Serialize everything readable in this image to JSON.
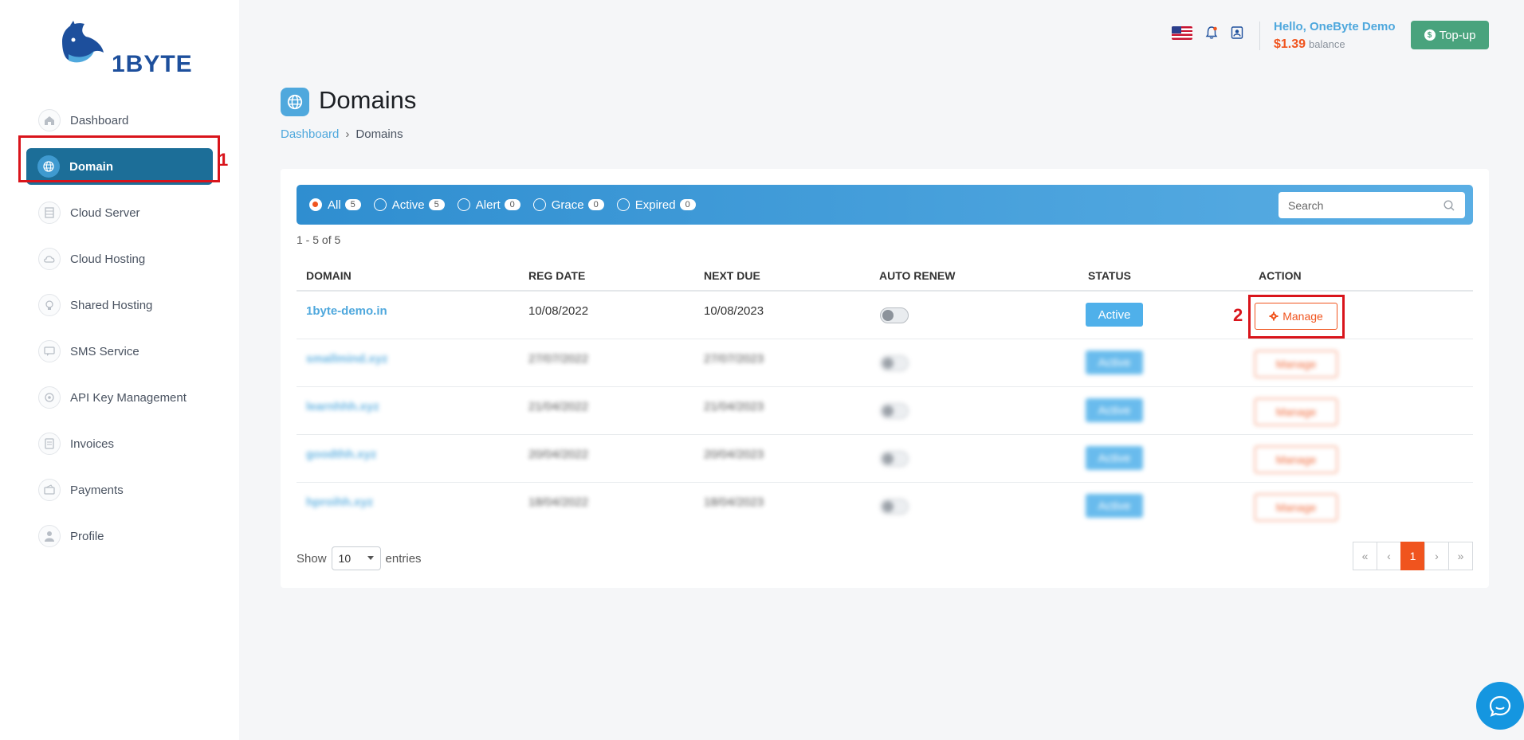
{
  "brand": {
    "logo_text": "1BYTE"
  },
  "sidebar": {
    "items": [
      {
        "label": "Dashboard",
        "icon": "home-icon"
      },
      {
        "label": "Domain",
        "icon": "globe-icon",
        "active": true
      },
      {
        "label": "Cloud Server",
        "icon": "server-icon"
      },
      {
        "label": "Cloud Hosting",
        "icon": "cloud-icon"
      },
      {
        "label": "Shared Hosting",
        "icon": "share-icon"
      },
      {
        "label": "SMS Service",
        "icon": "sms-icon"
      },
      {
        "label": "API Key Management",
        "icon": "key-icon"
      },
      {
        "label": "Invoices",
        "icon": "invoice-icon"
      },
      {
        "label": "Payments",
        "icon": "wallet-icon"
      },
      {
        "label": "Profile",
        "icon": "user-icon"
      }
    ]
  },
  "annotations": {
    "domain_marker": "1",
    "manage_marker": "2",
    "color": "#d9141b"
  },
  "header": {
    "greeting": "Hello, OneByte Demo",
    "balance": "$1.39",
    "balance_label": "balance",
    "topup_label": "Top-up",
    "topup_icon": "$"
  },
  "page": {
    "title": "Domains",
    "breadcrumb": {
      "home": "Dashboard",
      "separator": "›",
      "current": "Domains"
    }
  },
  "filters": [
    {
      "label": "All",
      "count": "5",
      "checked": true
    },
    {
      "label": "Active",
      "count": "5"
    },
    {
      "label": "Alert",
      "count": "0"
    },
    {
      "label": "Grace",
      "count": "0"
    },
    {
      "label": "Expired",
      "count": "0"
    }
  ],
  "search": {
    "placeholder": "Search"
  },
  "table": {
    "range": "1 - 5 of 5",
    "columns": [
      "DOMAIN",
      "REG DATE",
      "NEXT DUE",
      "AUTO RENEW",
      "STATUS",
      "ACTION"
    ],
    "rows": [
      {
        "domain": "1byte-demo.in",
        "reg": "10/08/2022",
        "due": "10/08/2023",
        "status": "Active",
        "action": "Manage",
        "blurred": false
      },
      {
        "domain": "smallmind.xyz",
        "reg": "27/07/2022",
        "due": "27/07/2023",
        "status": "Active",
        "action": "Manage",
        "blurred": true
      },
      {
        "domain": "learnhhh.xyz",
        "reg": "21/04/2022",
        "due": "21/04/2023",
        "status": "Active",
        "action": "Manage",
        "blurred": true
      },
      {
        "domain": "goodthh.xyz",
        "reg": "20/04/2022",
        "due": "20/04/2023",
        "status": "Active",
        "action": "Manage",
        "blurred": true
      },
      {
        "domain": "hproihh.xyz",
        "reg": "18/04/2022",
        "due": "18/04/2023",
        "status": "Active",
        "action": "Manage",
        "blurred": true
      }
    ]
  },
  "entries": {
    "show": "Show",
    "value": "10",
    "suffix": "entries"
  },
  "pagination": [
    "«",
    "‹",
    "1",
    "›",
    "»"
  ],
  "colors": {
    "accent": "#f0541e",
    "primary": "#4fa8dd",
    "nav_active": "#1c6e98",
    "topup": "#49a37d"
  }
}
